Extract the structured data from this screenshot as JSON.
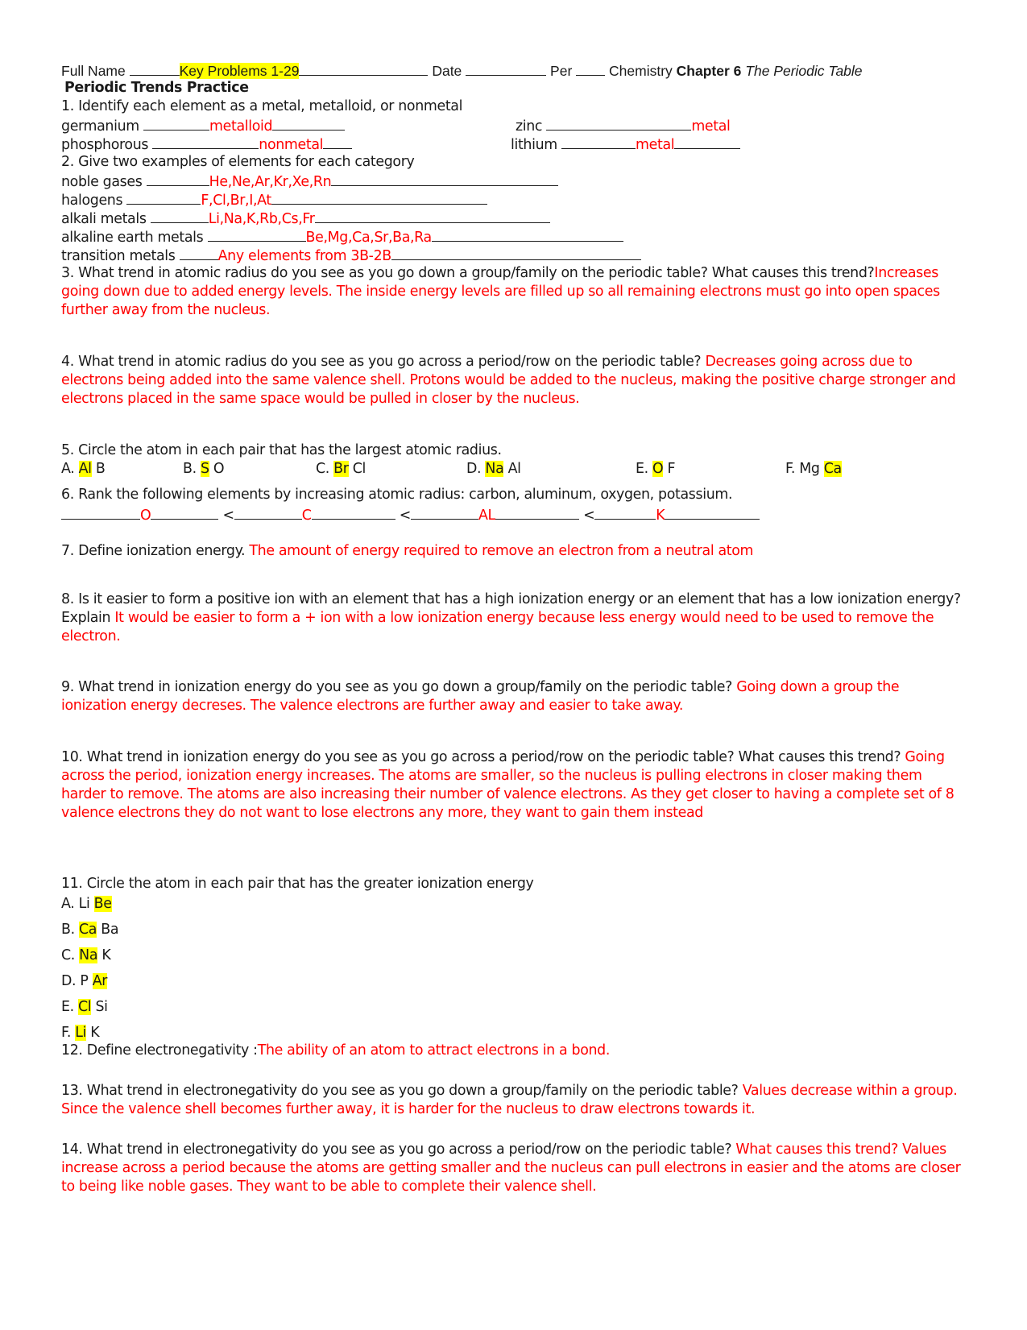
{
  "header": {
    "full_name_label": "Full Name",
    "full_name_value": "Key Problems 1-29",
    "date_label": "Date",
    "per_label": "Per",
    "course": "Chemistry",
    "chapter": "Chapter 6",
    "chapter_title": "The Periodic Table",
    "worksheet_title": "Periodic Trends Practice"
  },
  "q1": {
    "prompt": "1. Identify each element as a metal, metalloid, or nonmetal",
    "items": [
      {
        "element": "germanium",
        "answer": "metalloid"
      },
      {
        "element": "zinc",
        "answer": "metal"
      },
      {
        "element": "phosphorous",
        "answer": "nonmetal"
      },
      {
        "element": "lithium",
        "answer": "metal"
      }
    ]
  },
  "q2": {
    "prompt": "2. Give two examples of elements for each category",
    "items": [
      {
        "category": "noble gases",
        "answer": "He,Ne,Ar,Kr,Xe,Rn"
      },
      {
        "category": "halogens",
        "answer": "F,Cl,Br,I,At"
      },
      {
        "category": "alkali metals",
        "answer": "Li,Na,K,Rb,Cs,Fr"
      },
      {
        "category": "alkaline earth metals",
        "answer": "Be,Mg,Ca,Sr,Ba,Ra"
      },
      {
        "category": "transition metals",
        "answer": "Any elements from 3B-2B"
      }
    ]
  },
  "q3": {
    "prompt": "3. What trend in atomic radius do you see as you go down a group/family on the periodic table? What causes this trend?",
    "answer": "Increases going down due to added energy levels.  The inside energy levels are filled up so all remaining electrons must go into open spaces further away from the nucleus."
  },
  "q4": {
    "prompt": "4. What trend in atomic radius do you see as you go across a period/row on the periodic table? ",
    "answer": "Decreases going across due to electrons being added into the same valence shell.  Protons would be added to the nucleus, making the positive charge stronger and electrons placed in the same space would be pulled in closer by the nucleus."
  },
  "q5": {
    "prompt": "5. Circle the atom in each pair that has the largest atomic radius.",
    "options": [
      {
        "letter": "A.",
        "first": "Al",
        "second": "B",
        "selected": "first"
      },
      {
        "letter": "B.",
        "first": "S",
        "second": "O",
        "selected": "first"
      },
      {
        "letter": "C.",
        "first": "Br",
        "second": "Cl",
        "selected": "first"
      },
      {
        "letter": "D.",
        "first": "Na",
        "second": "Al",
        "selected": "first"
      },
      {
        "letter": "E.",
        "first": "O",
        "second": "F",
        "selected": "first"
      },
      {
        "letter": "F.",
        "first": "Mg",
        "second": "Ca",
        "selected": "second"
      }
    ]
  },
  "q6": {
    "prompt": "6. Rank the following elements by increasing atomic radius: carbon, aluminum, oxygen, potassium.",
    "ranking": [
      "O",
      "C",
      "AL",
      "K"
    ],
    "separator": "<"
  },
  "q7": {
    "prompt": "7. Define ionization energy. ",
    "answer": "The amount of energy required to remove an electron from a neutral atom"
  },
  "q8": {
    "prompt": "8. Is it easier to form a positive ion with an element that has a high ionization energy or an element that has a low ionization energy? Explain ",
    "answer": "It would be easier to form a + ion with a low ionization energy because less energy would need to be used to remove the electron."
  },
  "q9": {
    "prompt": "9. What trend in ionization energy do you see as you go down a group/family on the periodic table? ",
    "answer": "Going down a group the ionization energy decreses.  The valence electrons are further away and easier to take away."
  },
  "q10": {
    "prompt": "10. What trend in ionization energy do you see as you go across a period/row on the periodic table? What causes this trend? ",
    "answer": "Going across the period, ionization energy increases.  The atoms are smaller, so the nucleus is pulling electrons in closer making them harder to remove.  The atoms are also increasing their number of valence electrons.  As they get closer to having a complete set of 8 valence electrons they do not want to lose electrons any more, they want to gain them instead"
  },
  "q11": {
    "prompt": "11. Circle the atom in each pair that has the greater ionization energy",
    "options": [
      {
        "letter": "A.",
        "first": "Li",
        "second": "Be",
        "selected": "second"
      },
      {
        "letter": "B.",
        "first": "Ca",
        "second": "Ba",
        "selected": "first"
      },
      {
        "letter": "C.",
        "first": "Na",
        "second": "K",
        "selected": "first"
      },
      {
        "letter": "D.",
        "first": "P",
        "second": "Ar",
        "selected": "second"
      },
      {
        "letter": "E.",
        "first": "Cl",
        "second": "Si",
        "selected": "first"
      },
      {
        "letter": "F.",
        "first": "Li",
        "second": "K",
        "selected": "first"
      }
    ]
  },
  "q12": {
    "prompt": "12. Define electronegativity :",
    "answer": "The ability of an atom to attract electrons in a bond."
  },
  "q13": {
    "prompt": "13. What trend in electronegativity do you see as you go down a group/family on the periodic table? ",
    "answer": "Values decrease within a group.  Since the valence shell becomes further away, it is harder for the nucleus to draw electrons towards it."
  },
  "q14": {
    "prompt": "14. What trend in electronegativity do you see as you go across a period/row on the periodic table? ",
    "answer": "What causes this trend? Values increase across a period because the atoms are getting smaller and the nucleus can pull electrons in easier and the atoms are closer to being like noble gases.  They want to be able to complete their valence shell."
  },
  "colors": {
    "answer_text": "#ff0000",
    "highlight": "#ffff00",
    "body_text": "#1a1a1a"
  }
}
